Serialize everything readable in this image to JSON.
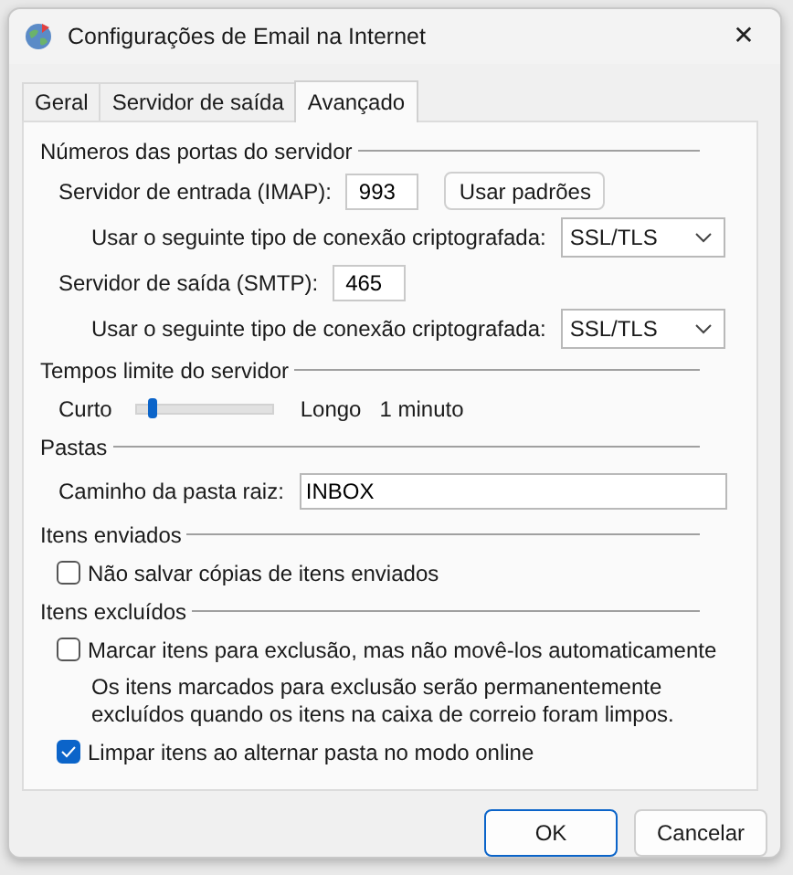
{
  "window": {
    "title": "Configurações de Email na Internet",
    "close": "✕"
  },
  "tabs": [
    {
      "label": "Geral",
      "selected": false
    },
    {
      "label": "Servidor de saída",
      "selected": false
    },
    {
      "label": "Avançado",
      "selected": true
    }
  ],
  "sections": [
    {
      "title": "Números das portas do servidor",
      "rows": [
        {
          "kind": "port",
          "label": "Servidor de entrada (IMAP):",
          "value": "993",
          "button": "Usar padrões"
        },
        {
          "kind": "encryption",
          "label": "Usar o seguinte tipo de conexão criptografada:",
          "value": "SSL/TLS"
        },
        {
          "kind": "port",
          "label": "Servidor de saída (SMTP):",
          "value": "465"
        },
        {
          "kind": "encryption",
          "label": "Usar o seguinte tipo de conexão criptografada:",
          "value": "SSL/TLS"
        }
      ]
    },
    {
      "title": "Tempos limite do servidor",
      "rows": [
        {
          "kind": "slider",
          "min_label": "Curto",
          "max_label": "Longo",
          "reading": "1 minuto",
          "level": 0.1
        }
      ]
    },
    {
      "title": "Pastas",
      "rows": [
        {
          "kind": "path",
          "label": "Caminho da pasta raiz:",
          "value": "INBOX"
        }
      ]
    },
    {
      "title": "Itens enviados",
      "rows": [
        {
          "kind": "checkbox",
          "label": "Não salvar cópias de itens enviados",
          "checked": false
        }
      ]
    },
    {
      "title": "Itens excluídos",
      "rows": [
        {
          "kind": "checkbox",
          "label": "Marcar itens para exclusão, mas não movê-los automaticamente",
          "checked": false
        },
        {
          "kind": "note",
          "text": "Os itens marcados para exclusão serão permanentemente excluídos quando os itens na caixa de correio foram limpos."
        },
        {
          "kind": "checkbox",
          "label": "Limpar itens ao alternar pasta no modo online",
          "checked": true
        }
      ]
    }
  ],
  "buttons": [
    {
      "label": "OK",
      "default": true
    },
    {
      "label": "Cancelar",
      "default": false
    }
  ]
}
